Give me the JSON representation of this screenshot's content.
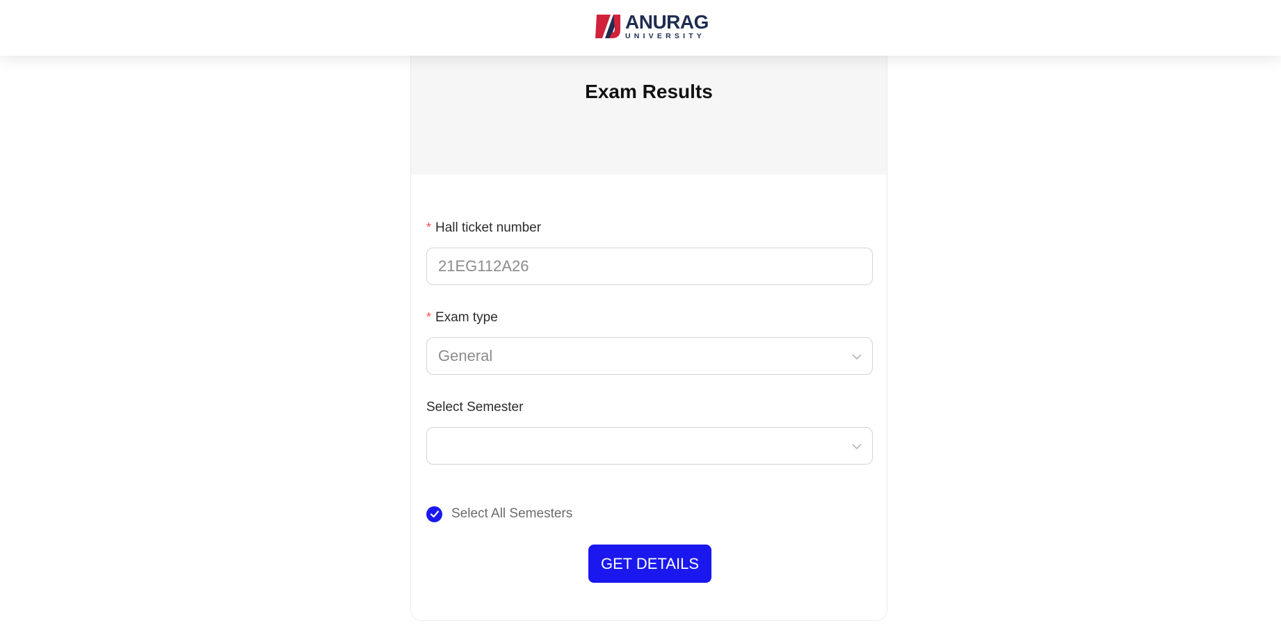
{
  "header": {
    "logo": {
      "primary": "ANURAG",
      "secondary": "UNIVERSITY",
      "colors": {
        "red": "#d0223a",
        "navy": "#1f2d52"
      }
    }
  },
  "card": {
    "title": "Exam Results",
    "fields": {
      "hall_ticket": {
        "required_mark": "*",
        "label": "Hall ticket number",
        "value": "21EG112A26"
      },
      "exam_type": {
        "required_mark": "*",
        "label": "Exam type",
        "selected": "General",
        "icon": "chevron-down-icon"
      },
      "semester": {
        "label": "Select Semester",
        "selected": "",
        "icon": "chevron-down-icon"
      }
    },
    "select_all": {
      "label": "Select All Semesters",
      "checked": true
    },
    "submit": {
      "label": "GET DETAILS"
    }
  },
  "colors": {
    "accent": "#1a18ee",
    "required": "#ff4d4f",
    "header_bg": "#f6f6f6"
  }
}
